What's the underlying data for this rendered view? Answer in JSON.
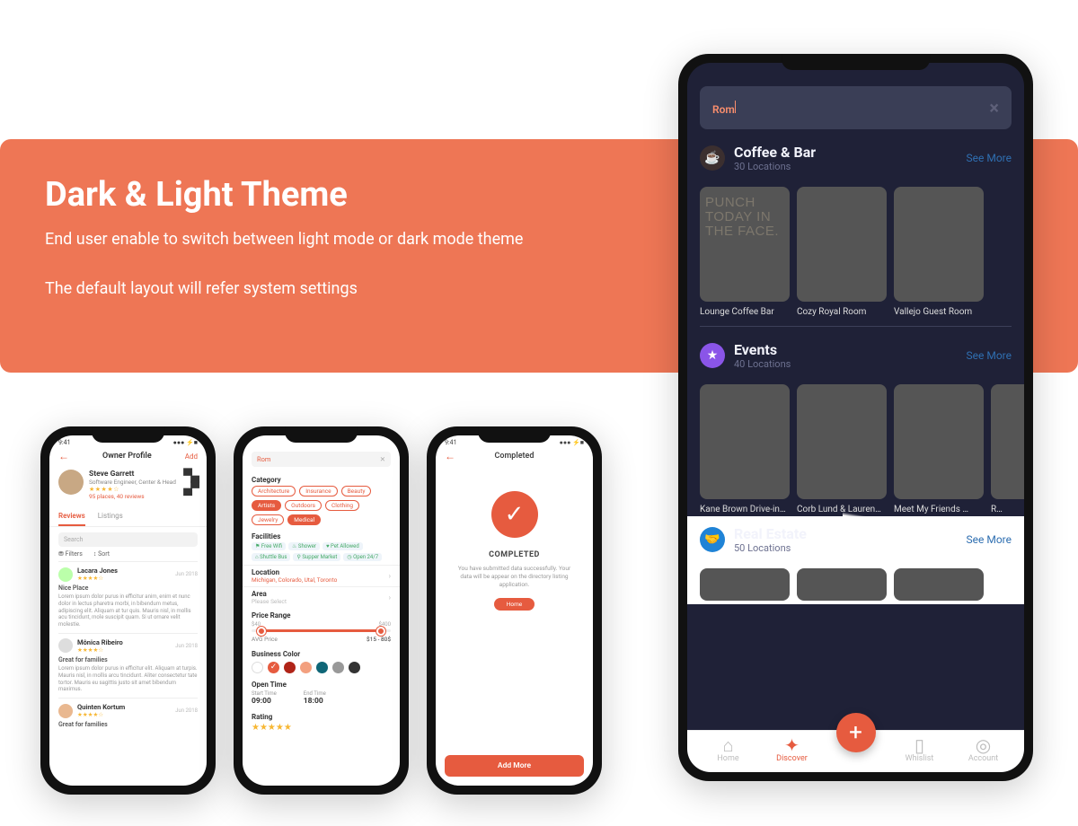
{
  "banner": {
    "title": "Dark & Light Theme",
    "p1": "End user enable to switch between light mode or dark mode theme",
    "p2": "The default layout will refer system settings"
  },
  "phone1": {
    "time": "9:41",
    "signal": "●●● ⚡■",
    "screen_title": "Owner Profile",
    "add": "Add",
    "owner": {
      "name": "Steve Garrett",
      "role": "Software Engineer, Center & Head",
      "meta": "95 places, 40 reviews"
    },
    "tabs": {
      "reviews": "Reviews",
      "listings": "Listings"
    },
    "search_ph": "Search",
    "filters": "⛃ Filters",
    "sort": "↕ Sort",
    "reviews": [
      {
        "name": "Lacara Jones",
        "date": "Jun 2018",
        "title": "Nice Place",
        "body": "Lorem ipsum dolor purus in efficitur anim, enim et nunc dolor in lectus pharetra morbi, in bibendum metus, adipiscing elit. Aliquam at tur quis. Mauris nisl, in mollis acu  tincidunt, mole suscipit quam. Si ut ornare velit molestie."
      },
      {
        "name": "Mônica Ribeiro",
        "date": "Jun 2018",
        "title": "Great for families",
        "body": "Lorem ipsum dolor purus in efficitur elit. Aliquam at turpis. Mauris nisl, in mollis arcu  tincidunt. Aliter consectetur tate tortor. Mauris eu sagittis justo sit amet bibendum maximus."
      },
      {
        "name": "Quinten Kortum",
        "date": "Jun 2018",
        "title": "Great for families",
        "body": ""
      }
    ]
  },
  "phone2": {
    "search_value": "Rom",
    "cat_label": "Category",
    "cats": [
      "Architecture",
      "Insurance",
      "Beauty",
      "Artists",
      "Outdoors",
      "Clothing",
      "Jewelry",
      "Medical"
    ],
    "cats_filled": [
      "Artists",
      "Medical"
    ],
    "fac_label": "Facilities",
    "facilities": [
      "⚑ Free Wifi",
      "♨ Shower",
      "♥ Pet Allowed",
      "⌂ Shuttle Bus",
      "⚲ Supper Market",
      "◷ Open 24/7"
    ],
    "loc_label": "Location",
    "loc_value": "Michigan, Colorado, Utal, Toronto",
    "area_label": "Area",
    "area_ph": "Please Select",
    "price_label": "Price Range",
    "price_min": "$40",
    "price_max": "$400",
    "avg_label": "AVG Price",
    "avg_value": "$15 - 80$",
    "bizcolor_label": "Business Color",
    "colors": [
      "#ffffff",
      "#E65B3F",
      "#b02418",
      "#f3a07f",
      "#0f6677",
      "#999999",
      "#333333"
    ],
    "checked_color_index": 1,
    "open_label": "Open Time",
    "start_label": "Start Time",
    "start_value": "09:00",
    "end_label": "End Time",
    "end_value": "18:00",
    "rating_label": "Rating"
  },
  "phone3": {
    "time": "9:41",
    "signal": "●●● ⚡■",
    "screen_title": "Completed",
    "completed_title": "COMPLETED",
    "completed_body": "You have submitted data successfully. Your data will be appear on the directory listing application.",
    "home_btn": "Home",
    "add_more": "Add More"
  },
  "dark": {
    "search_value": "Rom",
    "sections": [
      {
        "title": "Coffee & Bar",
        "sub": "30 Locations",
        "seemore": "See More",
        "icon": "coffee",
        "cards": [
          {
            "cap": "Lounge Coffee Bar",
            "cls": "thumb-a",
            "punch": "PUNCH\nTODAY\nIN THE\nFACE."
          },
          {
            "cap": "Cozy Royal Room",
            "cls": "thumb-b"
          },
          {
            "cap": "Vallejo Guest Room",
            "cls": "thumb-c"
          }
        ]
      },
      {
        "title": "Events",
        "sub": "40 Locations",
        "seemore": "See More",
        "icon": "star",
        "cards": [
          {
            "cap": "Kane Brown Drive-in…",
            "cls": "thumb-d"
          },
          {
            "cap": "Corb Lund & Lauren…",
            "cls": "thumb-e"
          },
          {
            "cap": "Meet My Friends …",
            "cls": "thumb-f"
          },
          {
            "cap": "R…",
            "cls": "thumb-d"
          }
        ]
      },
      {
        "title": "Real Estate",
        "sub": "50 Locations",
        "seemore": "See More",
        "icon": "estate",
        "cards": [
          {
            "cap": "",
            "cls": "thumb-g"
          },
          {
            "cap": "",
            "cls": "thumb-h"
          },
          {
            "cap": "",
            "cls": "thumb-i"
          }
        ]
      }
    ],
    "nav": {
      "home": "Home",
      "discover": "Discover",
      "whislist": "Whislist",
      "account": "Account"
    }
  }
}
